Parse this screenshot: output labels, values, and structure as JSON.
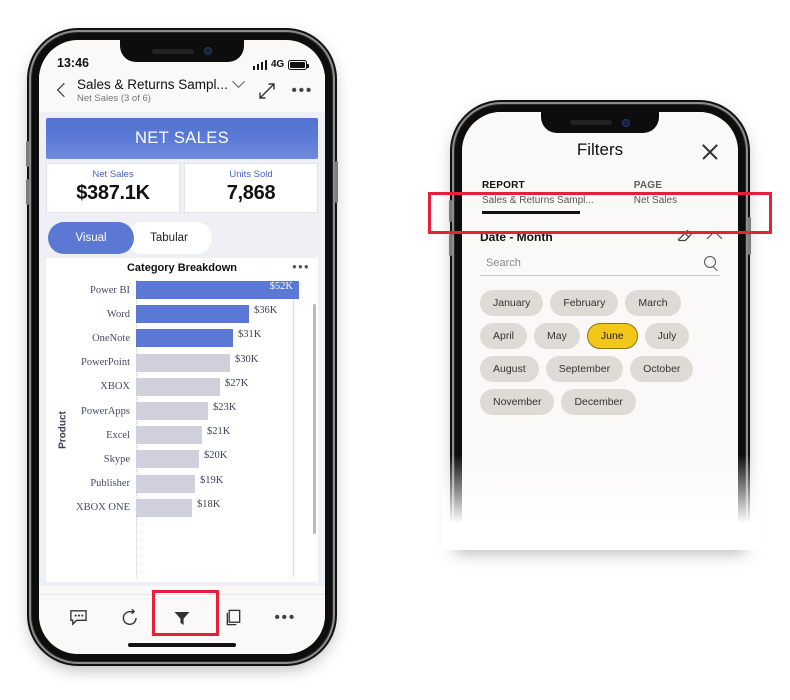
{
  "left_phone": {
    "status": {
      "time": "13:46",
      "network": "4G",
      "signal_icon": "signal-bars-icon",
      "battery_icon": "battery-icon"
    },
    "appbar": {
      "back_icon": "back-chevron-icon",
      "title": "Sales & Returns Sampl...",
      "subtitle": "Net Sales (3 of 6)",
      "dropdown_icon": "chevron-down-icon",
      "expand_icon": "expand-fullscreen-icon",
      "more_icon": "more-horizontal-icon"
    },
    "banner": {
      "label": "NET SALES"
    },
    "kpis": [
      {
        "label": "Net Sales",
        "value": "$387.1K"
      },
      {
        "label": "Units Sold",
        "value": "7,868"
      }
    ],
    "segments": [
      {
        "label": "Visual",
        "selected": true
      },
      {
        "label": "Tabular",
        "selected": false
      }
    ],
    "visual": {
      "title": "Category Breakdown",
      "more_icon": "more-horizontal-icon"
    },
    "tabbar": [
      {
        "name": "comment-icon",
        "label": "Comments"
      },
      {
        "name": "reset-icon",
        "label": "Reset"
      },
      {
        "name": "filter-funnel-icon",
        "label": "Filters",
        "highlighted": true
      },
      {
        "name": "bookmarks-icon",
        "label": "Bookmarks"
      },
      {
        "name": "more-horizontal-icon",
        "label": "More"
      }
    ]
  },
  "chart_data": {
    "type": "bar",
    "title": "Category Breakdown",
    "xlabel": "",
    "ylabel": "Product",
    "orientation": "horizontal",
    "categories": [
      "Power BI",
      "Word",
      "OneNote",
      "PowerPoint",
      "XBOX",
      "PowerApps",
      "Excel",
      "Skype",
      "Publisher",
      "XBOX ONE"
    ],
    "values": [
      52,
      36,
      31,
      30,
      27,
      23,
      21,
      20,
      19,
      18
    ],
    "value_labels": [
      "$52K",
      "$36K",
      "$31K",
      "$30K",
      "$27K",
      "$23K",
      "$21K",
      "$20K",
      "$19K",
      "$18K"
    ],
    "highlighted": [
      true,
      true,
      true,
      false,
      false,
      false,
      false,
      false,
      false,
      false
    ],
    "colors": {
      "highlight": "#5B79D4",
      "muted": "#CFD0DB"
    },
    "xlim": [
      0,
      56
    ],
    "grid": true,
    "legend": "none"
  },
  "right_phone": {
    "header": {
      "title": "Filters",
      "close_icon": "close-icon"
    },
    "scopes": [
      {
        "label": "REPORT",
        "value": "Sales & Returns Sampl...",
        "active": true
      },
      {
        "label": "PAGE",
        "value": "Net Sales",
        "active": false
      }
    ],
    "section": {
      "title": "Date - Month",
      "clear_icon": "eraser-icon",
      "collapse_icon": "chevron-up-icon",
      "search_placeholder": "Search",
      "search_value": "",
      "search_icon": "search-icon"
    },
    "months": [
      {
        "label": "January",
        "selected": false
      },
      {
        "label": "February",
        "selected": false
      },
      {
        "label": "March",
        "selected": false
      },
      {
        "label": "April",
        "selected": false
      },
      {
        "label": "May",
        "selected": false
      },
      {
        "label": "June",
        "selected": true
      },
      {
        "label": "July",
        "selected": false
      },
      {
        "label": "August",
        "selected": false
      },
      {
        "label": "September",
        "selected": false
      },
      {
        "label": "October",
        "selected": false
      },
      {
        "label": "November",
        "selected": false
      },
      {
        "label": "December",
        "selected": false
      }
    ]
  },
  "annotations": {
    "highlight_color": "#E81E3C",
    "boxes": [
      "filter-button-highlight",
      "scope-row-highlight"
    ]
  }
}
